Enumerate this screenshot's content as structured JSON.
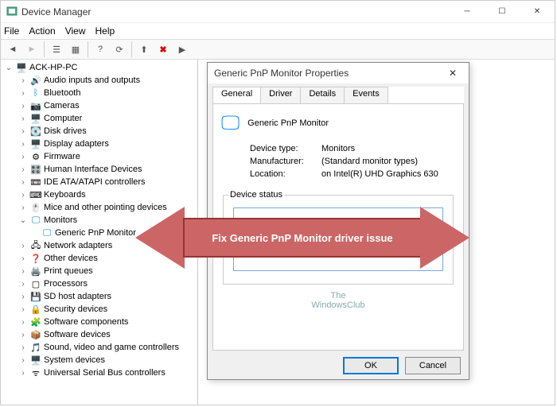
{
  "window": {
    "title": "Device Manager"
  },
  "menus": [
    "File",
    "Action",
    "View",
    "Help"
  ],
  "tree": {
    "root": "ACK-HP-PC",
    "items": [
      "Audio inputs and outputs",
      "Bluetooth",
      "Cameras",
      "Computer",
      "Disk drives",
      "Display adapters",
      "Firmware",
      "Human Interface Devices",
      "IDE ATA/ATAPI controllers",
      "Keyboards",
      "Mice and other pointing devices",
      "Monitors",
      "Network adapters",
      "Other devices",
      "Print queues",
      "Processors",
      "SD host adapters",
      "Security devices",
      "Software components",
      "Software devices",
      "Sound, video and game controllers",
      "System devices",
      "Universal Serial Bus controllers"
    ],
    "monitor_child": "Generic PnP Monitor"
  },
  "dialog": {
    "title": "Generic PnP Monitor Properties",
    "tabs": [
      "General",
      "Driver",
      "Details",
      "Events"
    ],
    "device_name": "Generic PnP Monitor",
    "prop_keys": {
      "type": "Device type:",
      "mfr": "Manufacturer:",
      "loc": "Location:"
    },
    "prop_vals": {
      "type": "Monitors",
      "mfr": "(Standard monitor types)",
      "loc": "on Intel(R) UHD Graphics 630"
    },
    "status_label": "Device status",
    "watermark_line1": "The",
    "watermark_line2": "WindowsClub",
    "ok": "OK",
    "cancel": "Cancel"
  },
  "overlay": {
    "text": "Fix Generic PnP Monitor driver issue"
  }
}
